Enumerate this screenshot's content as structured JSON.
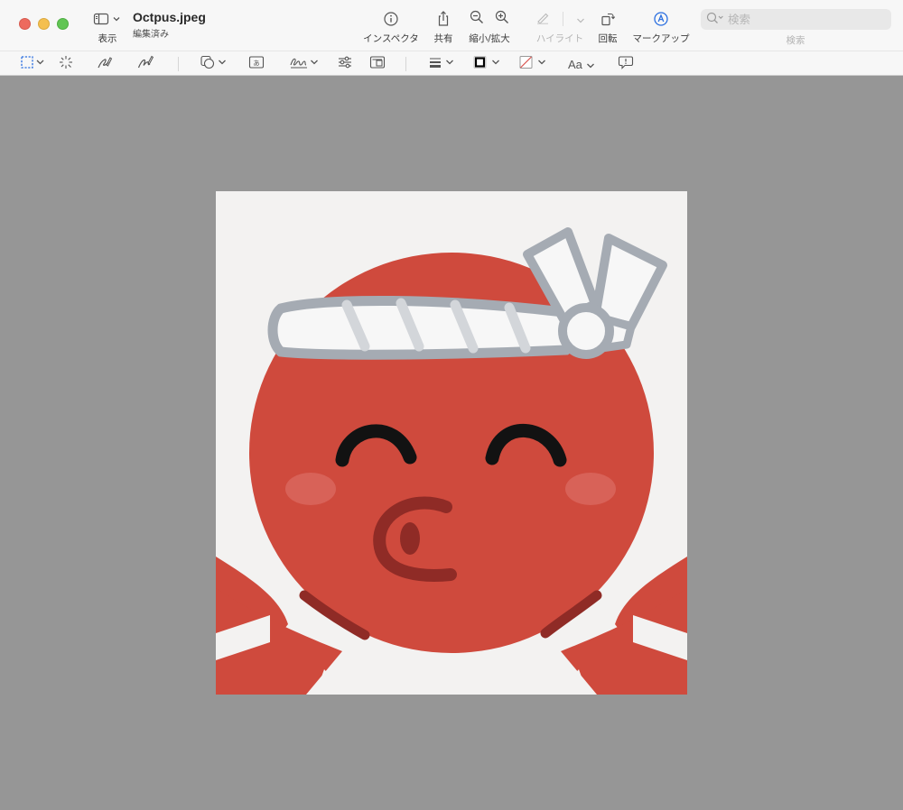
{
  "window": {
    "title": "Octpus.jpeg",
    "subtitle": "編集済み"
  },
  "toolbar": {
    "view_label": "表示",
    "inspector_label": "インスペクタ",
    "share_label": "共有",
    "zoom_label": "縮小/拡大",
    "highlight_label": "ハイライト",
    "rotate_label": "回転",
    "markup_label": "マークアップ",
    "search_label": "検索"
  },
  "search": {
    "placeholder": "検索",
    "value": ""
  },
  "markup": {
    "font_label": "Aa",
    "colors": {
      "border": "#000000",
      "fill_none_slash": "#d9534f",
      "accent": "#2b6fe0"
    }
  },
  "image": {
    "icons": [
      "octopus-illustration"
    ],
    "colors": {
      "body": "#cf4a3d",
      "band": "#f7f7f7",
      "band_outline": "#a5abb3"
    }
  }
}
